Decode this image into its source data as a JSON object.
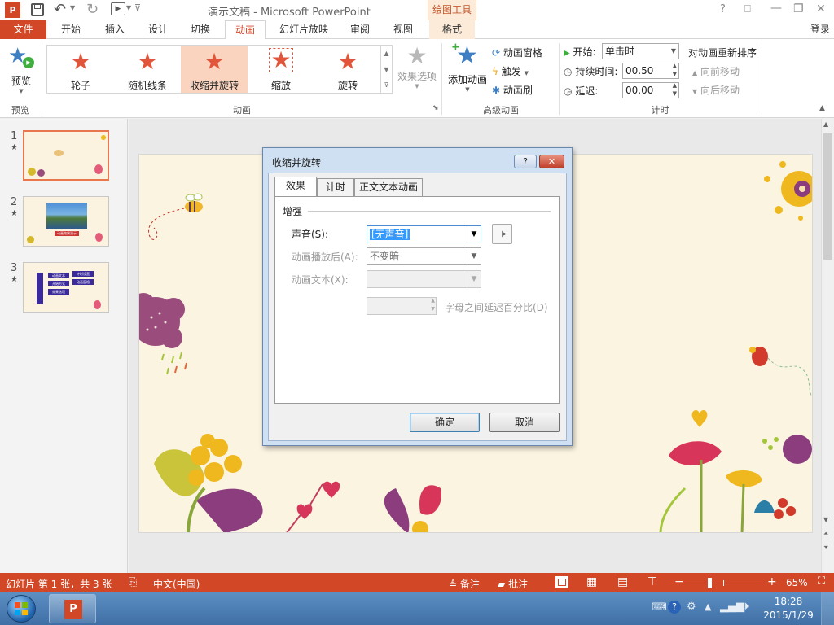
{
  "window": {
    "title": "演示文稿 - Microsoft PowerPoint",
    "contextual_tab": "绘图工具",
    "signin": "登录",
    "controls": {
      "help": "?",
      "minimize": "—",
      "restore": "❐",
      "close": "✕"
    }
  },
  "tabs": [
    "文件",
    "开始",
    "插入",
    "设计",
    "切换",
    "动画",
    "幻灯片放映",
    "审阅",
    "视图",
    "格式"
  ],
  "ribbon": {
    "preview": {
      "button": "预览",
      "group": "预览"
    },
    "animation_gallery": {
      "items": [
        "轮子",
        "随机线条",
        "收缩并旋转",
        "缩放",
        "旋转"
      ],
      "selected": "收缩并旋转",
      "group": "动画",
      "effect_options": "效果选项"
    },
    "advanced": {
      "add_animation": "添加动画",
      "animation_pane": "动画窗格",
      "trigger": "触发",
      "painter": "动画刷",
      "group": "高级动画"
    },
    "timing": {
      "start_label": "开始:",
      "start_value": "单击时",
      "duration_label": "持续时间:",
      "duration_value": "00.50",
      "delay_label": "延迟:",
      "delay_value": "00.00",
      "reorder_title": "对动画重新排序",
      "move_earlier": "向前移动",
      "move_later": "向后移动",
      "group": "计时"
    }
  },
  "slides": [
    {
      "num": "1",
      "star": "★"
    },
    {
      "num": "2",
      "star": "★",
      "caption": "动画效果演示"
    },
    {
      "num": "3",
      "star": "★",
      "boxes": [
        "动画文本",
        "开始方式",
        "效果选项",
        "计时设置",
        "动画窗格"
      ]
    }
  ],
  "dialog": {
    "title": "收缩并旋转",
    "help": "?",
    "close": "✕",
    "tabs": [
      "效果",
      "计时",
      "正文文本动画"
    ],
    "active_tab": "效果",
    "section": "增强",
    "sound_label": "声音(S):",
    "sound_value": "[无声音]",
    "after_label": "动画播放后(A):",
    "after_value": "不变暗",
    "text_label": "动画文本(X):",
    "text_value": "",
    "delay_pct_label": "字母之间延迟百分比(D)",
    "ok": "确定",
    "cancel": "取消"
  },
  "statusbar": {
    "slide_info": "幻灯片 第 1 张，共 3 张",
    "language": "中文(中国)",
    "notes": "备注",
    "comments": "批注",
    "zoom_minus": "−",
    "zoom_plus": "+",
    "zoom": "65%",
    "zoom_fraction": 0.65
  },
  "taskbar": {
    "time": "18:28",
    "date": "2015/1/29"
  },
  "colors": {
    "accent": "#d24726",
    "selected_gallery": "#fbd4c0",
    "slide_background": "#fbf4e1",
    "dialog_frame": "#cfe0f3"
  }
}
